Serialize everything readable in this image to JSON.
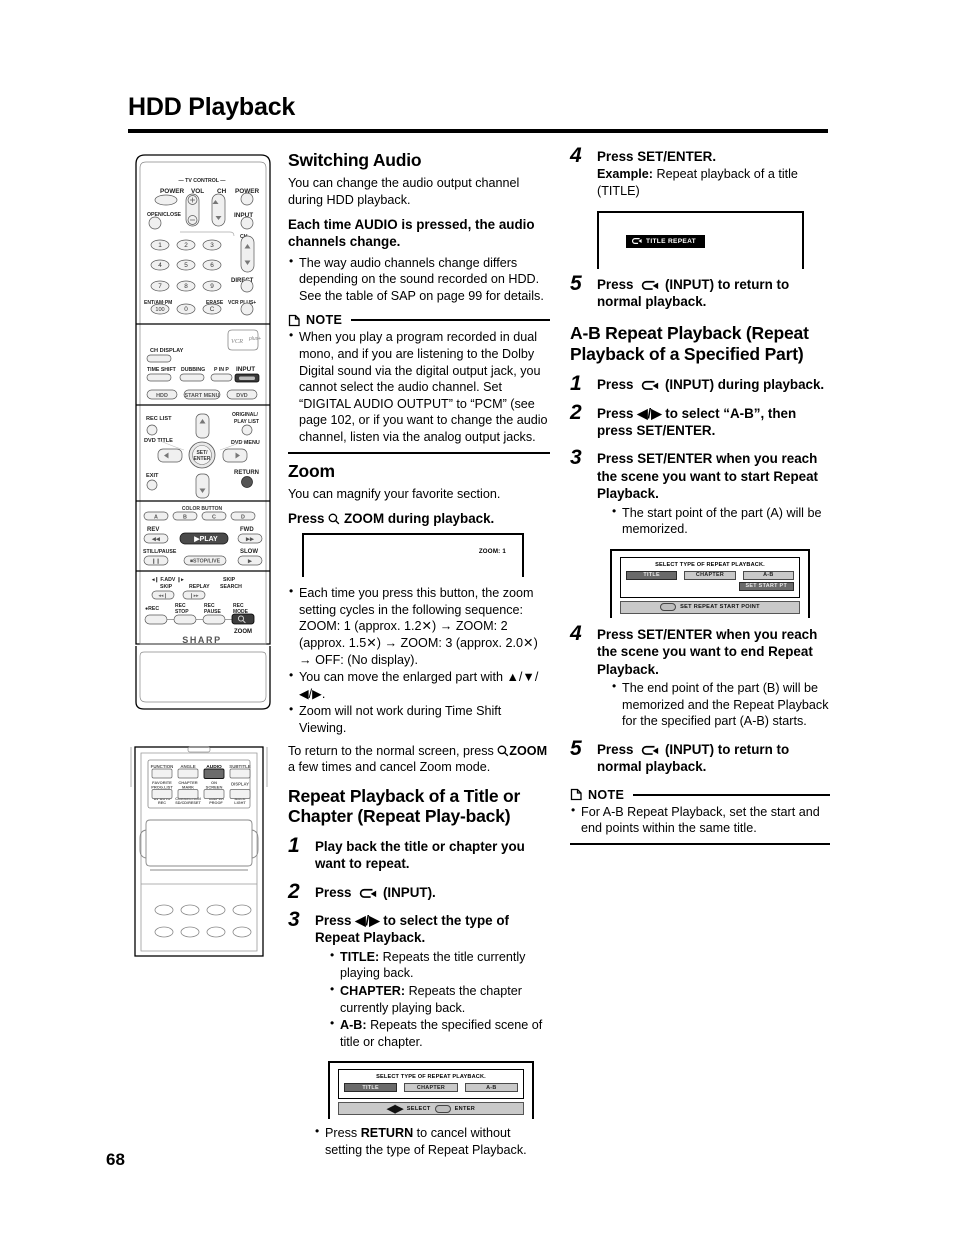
{
  "page": {
    "title": "HDD Playback",
    "number": "68"
  },
  "col1": {
    "switching_audio": {
      "heading": "Switching Audio",
      "intro": "You can change the audio output channel during HDD playback.",
      "lead_pre": "Each time ",
      "lead_bold": "AUDIO",
      "lead_post": " is pressed, the audio channels change.",
      "bullets": [
        "The way audio channels change differs depending on the sound recorded on HDD. See the table of SAP on page 99 for details."
      ],
      "note_label": "NOTE",
      "note_bullets": [
        "When you play a program recorded in dual mono, and if you are listening to the Dolby Digital sound via the digital output jack, you cannot select the audio channel. Set “DIGITAL AUDIO OUTPUT” to “PCM” (see page 102, or if you want to change the audio channel, listen via the analog output jacks."
      ]
    },
    "zoom": {
      "heading": "Zoom",
      "intro": "You can magnify your favorite section.",
      "lead_pre": "Press ",
      "lead_icon": "magnifier-icon",
      "lead_bold": "ZOOM",
      "lead_post": " during playback.",
      "tv_display": "ZOOM: 1",
      "bullets": [
        "Each time you press this button, the zoom setting cycles in the following sequence: ZOOM: 1 (approx. 1.2✕) → ZOOM: 2 (approx. 1.5✕) → ZOOM: 3 (approx. 2.0✕) → OFF: (No display).",
        "You can move the enlarged part with ▲/▼/◀/▶.",
        "Zoom will not work during Time Shift Viewing."
      ],
      "closing_pre": "To return to the normal screen, press ",
      "closing_bold": "ZOOM",
      "closing_post": " a few times and cancel Zoom mode."
    },
    "repeat": {
      "heading": "Repeat Playback of a Title or Chapter (Repeat Play-back)",
      "steps": [
        {
          "num": "1",
          "text": "Play back the title or chapter you want to repeat."
        },
        {
          "num": "2",
          "text_pre": "Press ",
          "icon": "input-icon",
          "text_post": " (INPUT)."
        },
        {
          "num": "3",
          "text_pre": "Press ◀/▶ to select the type of Repeat Playback.",
          "bullets": [
            {
              "label": "TITLE:",
              "text": " Repeats the title currently playing back."
            },
            {
              "label": "CHAPTER:",
              "text": " Repeats the chapter currently playing back."
            },
            {
              "label": "A-B:",
              "text": " Repeats the specified scene of title or chapter."
            }
          ]
        }
      ],
      "osd": {
        "header": "SELECT TYPE OF REPEAT PLAYBACK.",
        "buttons": [
          "TITLE",
          "CHAPTER",
          "A-B"
        ],
        "selected": "TITLE",
        "footer": "SELECT",
        "footer2": "ENTER"
      },
      "closing_pre": "Press ",
      "closing_bold": "RETURN",
      "closing_post": " to cancel without setting the type of Repeat Playback."
    }
  },
  "col2": {
    "steps_top": [
      {
        "num": "4",
        "text": "Press SET/ENTER.",
        "sub_label": "Example:",
        "sub_text": " Repeat playback of a title (TITLE)"
      },
      {
        "num": "5",
        "text_pre": "Press ",
        "icon": "input-icon",
        "text_post": " (INPUT) to return to normal playback."
      }
    ],
    "tv_title_banner": "TITLE REPEAT",
    "ab": {
      "heading": "A-B Repeat Playback (Repeat Playback of a Specified Part)",
      "steps": [
        {
          "num": "1",
          "text_pre": "Press ",
          "icon": "input-icon",
          "text_post": " (INPUT) during playback."
        },
        {
          "num": "2",
          "text": "Press ◀/▶ to select “A-B”, then press SET/ENTER."
        },
        {
          "num": "3",
          "text": "Press SET/ENTER when you reach the scene you want to start Repeat Playback.",
          "bullets": [
            "The start point of the part (A) will be memorized."
          ]
        },
        {
          "num": "4",
          "text": "Press SET/ENTER when you reach the scene you want to end Repeat Playback.",
          "bullets": [
            "The end point of the part (B) will be memorized and the Repeat Playback for the specified part (A-B) starts."
          ]
        },
        {
          "num": "5",
          "text_pre": "Press ",
          "icon": "input-icon",
          "text_post": " (INPUT) to return to normal playback."
        }
      ],
      "osd": {
        "header": "SELECT TYPE OF REPEAT PLAYBACK.",
        "buttons": [
          "TITLE",
          "CHAPTER",
          "A-B"
        ],
        "selected": "TITLE",
        "sub_button": "SET START PT",
        "footer": "SET REPEAT START POINT"
      },
      "note_label": "NOTE",
      "note_bullets": [
        "For A-B Repeat Playback, set the start and end points within the same title."
      ]
    }
  },
  "remote_top": {
    "tv_control": "— TV CONTROL —",
    "labels": {
      "power": "POWER",
      "vol": "VOL",
      "ch": "CH",
      "power2": "POWER",
      "open_close": "OPEN/CLOSE",
      "input": "INPUT",
      "ch2": "CH",
      "direct": "DIRECT",
      "ent_ampm": "ENT/AM·PM",
      "erase": "ERASE",
      "vcrplus": "VCR PLUS+",
      "keys": [
        "1",
        "2",
        "3",
        "4",
        "5",
        "6",
        "7",
        "8",
        "9",
        "100",
        "0",
        "C"
      ],
      "ch_display": "CH DISPLAY",
      "time_shift": "TIME SHIFT",
      "dubbing": "DUBBING",
      "pinp": "P IN P",
      "input2": "INPUT",
      "hdd": "HDD",
      "start_menu": "START MENU",
      "dvd": "DVD",
      "rec_list": "REC LIST",
      "original_playlist": "ORIGINAL/ PLAY LIST",
      "dvd_title": "DVD TITLE",
      "dvd_menu": "DVD MENU",
      "set_enter": "SET/ ENTER",
      "exit": "EXIT",
      "return": "RETURN",
      "color_button": "COLOR BUTTON",
      "abcd": [
        "A",
        "B",
        "C",
        "D"
      ],
      "rev": "REV",
      "fwd": "FWD",
      "play": "PLAY",
      "still_pause": "STILL/PAUSE",
      "slow": "SLOW",
      "stop_live": "STOP/LIVE",
      "f_adv": "F.ADV",
      "skip": "SKIP",
      "replay": "REPLAY",
      "skip_search": "SKIP SEARCH",
      "rec": "REC",
      "rec_stop": "REC STOP",
      "rec_pause": "REC PAUSE",
      "rec_mode": "REC MODE",
      "zoom": "ZOOM",
      "brand": "SHARP"
    }
  },
  "remote_bottom": {
    "row1": [
      "FUNCTION",
      "ANGLE",
      "AUDIO",
      "SUBTITLE"
    ],
    "row2": [
      "FAVORITE PROG.LIST",
      "CHAPTER MARK",
      "ON SCREEN",
      "DISPLAY"
    ],
    "row3": [
      "AV AUTO REC",
      "CORRECTION SD/CD/RESET",
      "TAMPER PROOF",
      "BACK LIGHT"
    ],
    "highlighted": "AUDIO"
  }
}
